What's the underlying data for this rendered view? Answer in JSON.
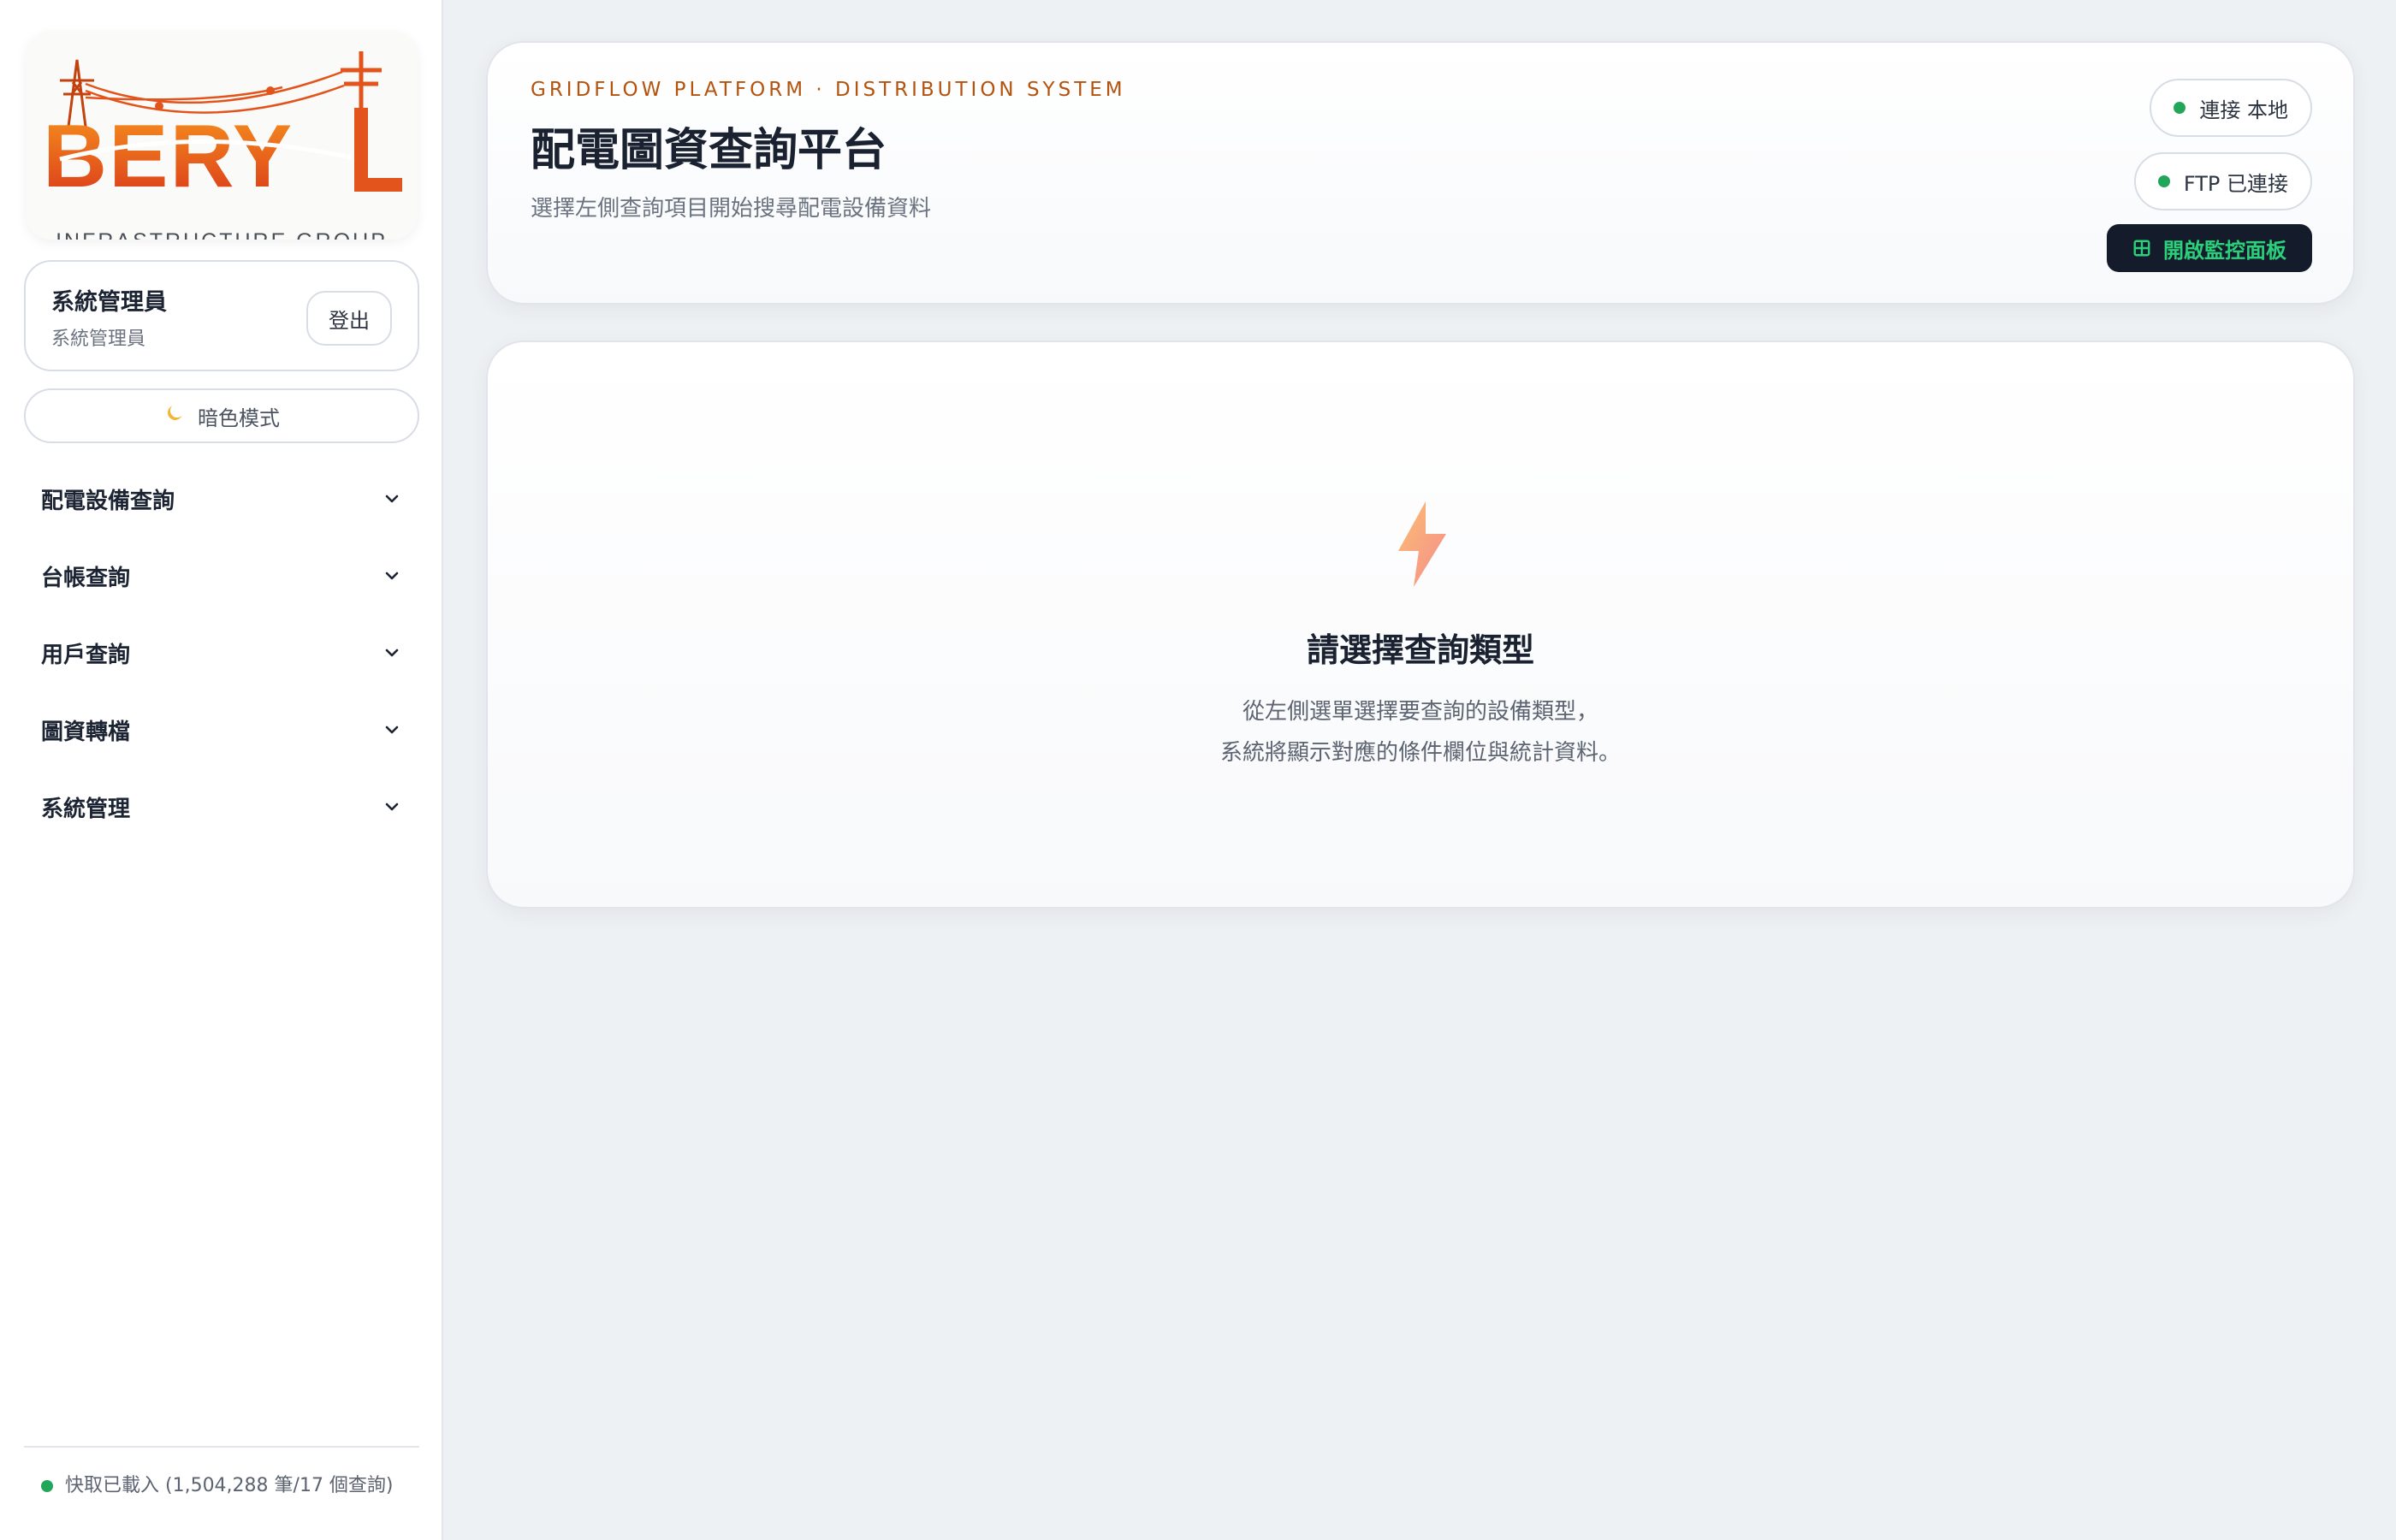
{
  "brand": {
    "logo_text": "BERYL",
    "tagline": "INFRASTRUCTURE GROUP"
  },
  "user": {
    "name": "系統管理員",
    "role": "系統管理員",
    "logout_label": "登出"
  },
  "theme_toggle": {
    "icon": "moon-icon",
    "label": "暗色模式"
  },
  "nav": {
    "items": [
      {
        "label": "配電設備查詢"
      },
      {
        "label": "台帳查詢"
      },
      {
        "label": "用戶查詢"
      },
      {
        "label": "圖資轉檔"
      },
      {
        "label": "系統管理"
      }
    ]
  },
  "footer": {
    "cache_status": "快取已載入 (1,504,288 筆/17 個查詢)"
  },
  "header": {
    "eyebrow": "GRIDFLOW PLATFORM · DISTRIBUTION SYSTEM",
    "title": "配電圖資查詢平台",
    "subtitle": "選擇左側查詢項目開始搜尋配電設備資料",
    "connection_label": "連接 本地",
    "ftp_label": "FTP 已連接",
    "monitor_label": "開啟監控面板"
  },
  "empty_state": {
    "icon": "lightning-icon",
    "title": "請選擇查詢類型",
    "line1": "從左側選單選擇要查詢的設備類型，",
    "line2": "系統將顯示對應的條件欄位與統計資料。"
  },
  "colors": {
    "accent": "#b4530d",
    "status_green": "#22a75a",
    "monitor_text": "#2bd07a",
    "monitor_bg": "#141c2b",
    "logo_orange": "#e8501b"
  }
}
